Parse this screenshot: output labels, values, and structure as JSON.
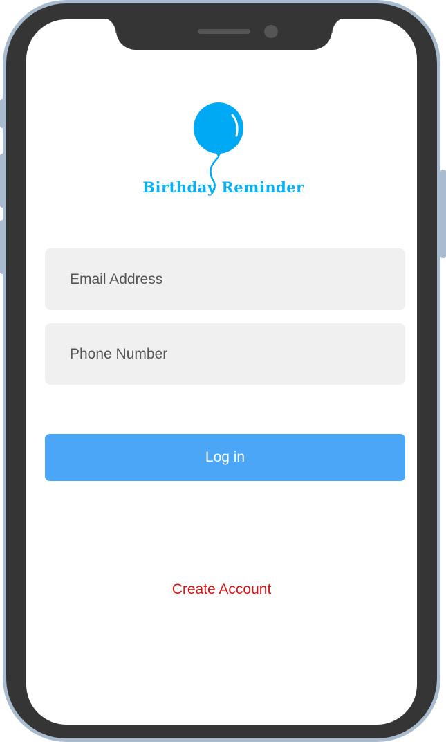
{
  "app": {
    "name": "Birthday Reminder",
    "brand_color": "#0ab0f2",
    "logo_icon": "balloon-icon"
  },
  "form": {
    "email": {
      "placeholder": "Email Address",
      "value": ""
    },
    "phone": {
      "placeholder": "Phone Number",
      "value": ""
    },
    "login_label": "Log in",
    "login_color": "#4ca6f7",
    "create_account_label": "Create Account",
    "create_account_color": "#d71313"
  }
}
